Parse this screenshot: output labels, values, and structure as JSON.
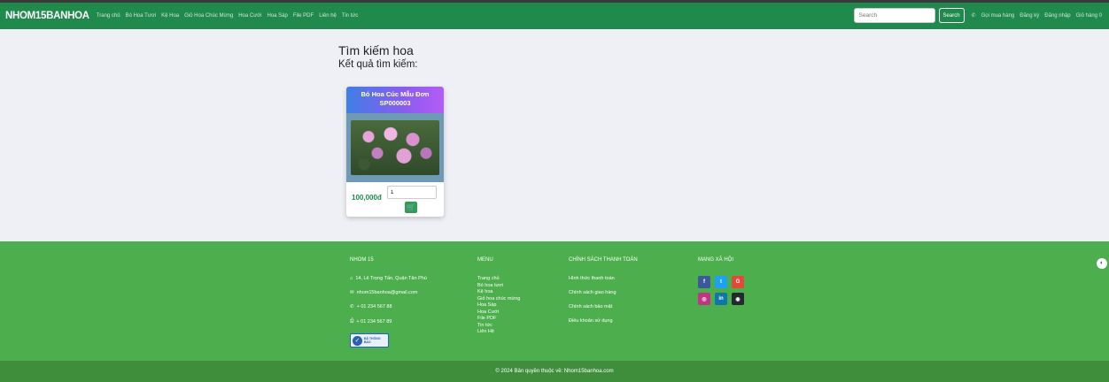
{
  "navbar": {
    "brand": "NHOM15BANHOA",
    "links": [
      "Trang chủ",
      "Bó Hoa Tươi",
      "Kệ Hoa",
      "Giỏ Hoa Chúc Mừng",
      "Hoa Cưới",
      "Hoa Sáp",
      "File PDF",
      "Liên hệ",
      "Tin tức"
    ],
    "search_placeholder": "Search",
    "search_button": "Search",
    "call_label": "Gọi mua hàng",
    "register_label": "Đăng ký",
    "login_label": "Đăng nhập",
    "cart_label": "Giỏ hàng 0"
  },
  "main": {
    "title": "Tìm kiếm hoa",
    "results_label": "Kết quả tìm kiếm:"
  },
  "product": {
    "name": "Bó Hoa Cúc Mẫu Đơn",
    "code": "SP000003",
    "price": "100,000đ",
    "quantity": "1"
  },
  "footer": {
    "col1": {
      "title": "NHOM 15",
      "address": "14, Lê Trọng Tấn, Quận Tân Phú",
      "email": "nhom15banhoa@gmail.com",
      "phone": "+ 01 234 567 88",
      "fax": "+ 01 234 567 89",
      "badge_text": "ĐÃ THÔNG BÁO"
    },
    "col2": {
      "title": "MENU",
      "items": [
        "Trang chủ",
        "Bó hoa tươi",
        "Kệ hoa",
        "Giỏ hoa chúc mừng",
        "Hoa Sáp",
        "Hoa Cưới",
        "File PDF",
        "Tin tức",
        "Liên Hệ"
      ]
    },
    "col3": {
      "title": "CHÍNH SÁCH THANH TOÁN",
      "items": [
        "Hình thức thanh toán",
        "Chính sách giao hàng",
        "Chính sách bảo mật",
        "Điều khoản sử dụng"
      ]
    },
    "col4": {
      "title": "MẠNG XÃ HỘI",
      "socials": [
        {
          "label": "f",
          "color": "#3b5998",
          "name": "facebook-icon"
        },
        {
          "label": "t",
          "color": "#1da1f2",
          "name": "twitter-icon"
        },
        {
          "label": "G",
          "color": "#dd4b39",
          "name": "google-icon"
        },
        {
          "label": "◎",
          "color": "#c13584",
          "name": "instagram-icon"
        },
        {
          "label": "in",
          "color": "#0e76a8",
          "name": "linkedin-icon"
        },
        {
          "label": "◉",
          "color": "#24292e",
          "name": "github-icon"
        }
      ]
    },
    "copyright": "© 2024 Bản quyền thuộc về: Nhom15banhoa.com"
  },
  "colors": {
    "nav_bg": "#1f8a4c",
    "footer_bg": "#4cae4c",
    "bottom_bg": "#3f8e3c",
    "price": "#1f8a4c"
  }
}
